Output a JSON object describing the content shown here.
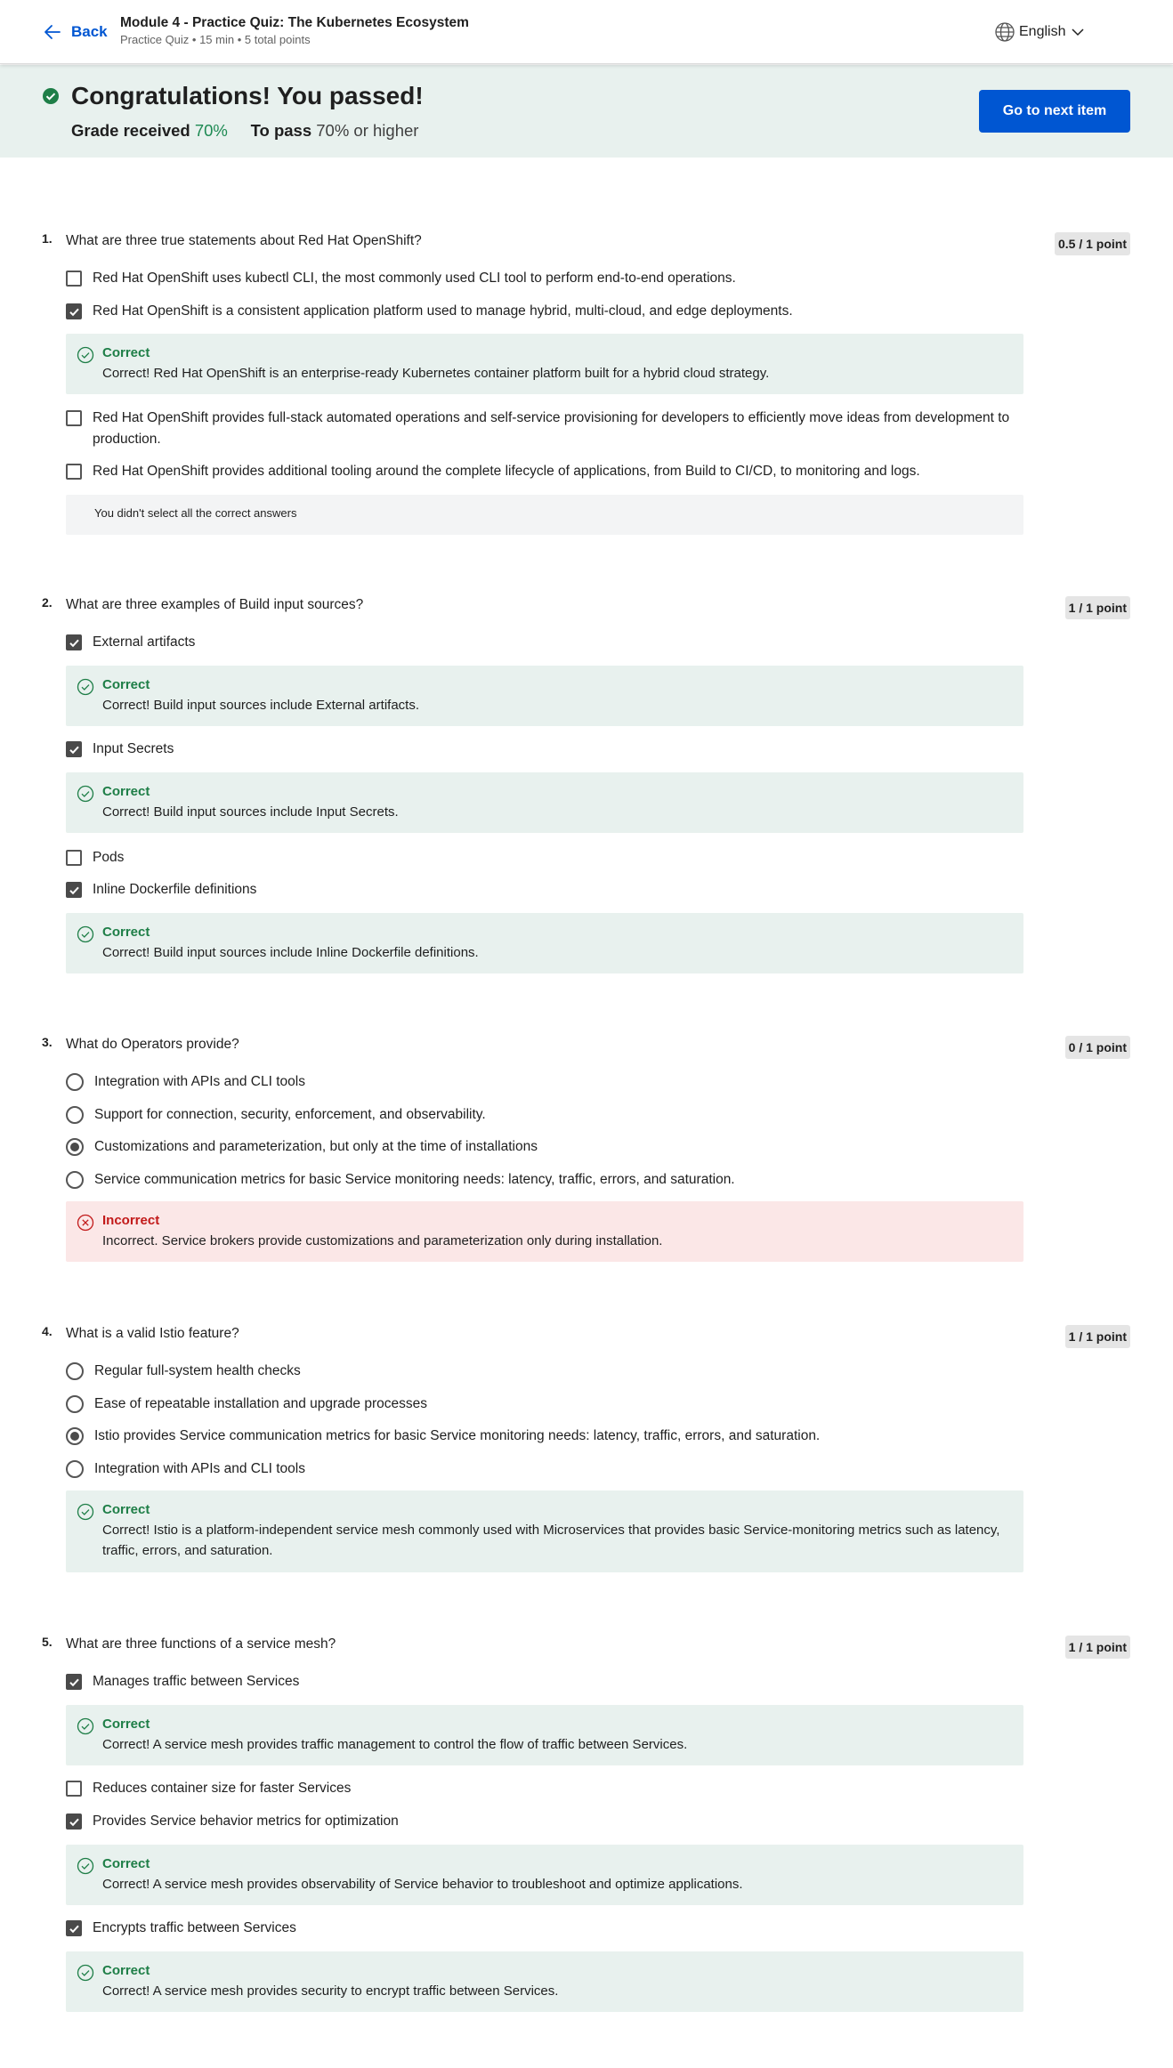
{
  "header": {
    "back_label": "Back",
    "title": "Module 4 - Practice Quiz: The Kubernetes Ecosystem",
    "subtitle": "Practice Quiz • 15 min • 5 total points",
    "language": "English"
  },
  "banner": {
    "message": "Congratulations! You passed!",
    "grade_label": "Grade received",
    "grade_value": "70%",
    "pass_label": "To pass",
    "pass_value": "70% or higher",
    "next_button": "Go to next item"
  },
  "colors": {
    "accent": "#0056d2",
    "correct": "#1e7e47",
    "incorrect": "#c21a1a",
    "correct_bg": "#e8f1ee",
    "incorrect_bg": "#fbe7e7"
  },
  "questions": [
    {
      "number": "1.",
      "text": "What are three true statements about Red Hat OpenShift?",
      "points": "0.5 / 1 point",
      "options": [
        {
          "label": "Red Hat OpenShift uses kubectl CLI, the most commonly used CLI tool to perform end-to-end operations.",
          "checked": false
        },
        {
          "label": "Red Hat OpenShift is a consistent application platform used to manage hybrid, multi-cloud, and edge deployments.",
          "checked": true,
          "feedback": {
            "status": "Correct",
            "text": "Correct! Red Hat OpenShift is an enterprise-ready Kubernetes container platform built for a hybrid cloud strategy."
          }
        },
        {
          "label": "Red Hat OpenShift provides full-stack automated operations and self-service provisioning for developers to efficiently move ideas from development to production.",
          "checked": false
        },
        {
          "label": "Red Hat OpenShift provides additional tooling around the complete lifecycle of applications, from Build to CI/CD, to monitoring and logs.",
          "checked": false
        }
      ],
      "note": "You didn't select all the correct answers"
    },
    {
      "number": "2.",
      "text": "What are three examples of Build input sources?",
      "points": "1 / 1 point",
      "options": [
        {
          "label": "External artifacts",
          "checked": true,
          "feedback": {
            "status": "Correct",
            "text": "Correct! Build input sources include External artifacts."
          }
        },
        {
          "label": "Input Secrets",
          "checked": true,
          "feedback": {
            "status": "Correct",
            "text": "Correct! Build input sources include Input Secrets."
          }
        },
        {
          "label": "Pods",
          "checked": false
        },
        {
          "label": "Inline Dockerfile definitions",
          "checked": true,
          "feedback": {
            "status": "Correct",
            "text": "Correct! Build input sources include Inline Dockerfile definitions."
          }
        }
      ]
    },
    {
      "number": "3.",
      "text": "What do Operators provide?",
      "points": "0 / 1 point",
      "options": [
        {
          "label": "Integration with APIs and CLI tools",
          "selected": false
        },
        {
          "label": "Support for connection, security, enforcement, and observability.",
          "selected": false
        },
        {
          "label": "Customizations and parameterization, but only at the time of installations",
          "selected": true
        },
        {
          "label": "Service communication metrics for basic Service monitoring needs: latency, traffic, errors, and saturation.",
          "selected": false
        }
      ],
      "feedback": {
        "status": "Incorrect",
        "text": "Incorrect. Service brokers provide customizations and parameterization only during installation."
      }
    },
    {
      "number": "4.",
      "text": "What is a valid Istio feature?",
      "points": "1 / 1 point",
      "options": [
        {
          "label": "Regular full-system health checks",
          "selected": false
        },
        {
          "label": "Ease of repeatable installation and upgrade processes",
          "selected": false
        },
        {
          "label": "Istio provides Service communication metrics for basic Service monitoring needs: latency, traffic, errors, and saturation.",
          "selected": true
        },
        {
          "label": "Integration with APIs and CLI tools",
          "selected": false
        }
      ],
      "feedback": {
        "status": "Correct",
        "text": "Correct! Istio is a platform-independent service mesh commonly used with Microservices that provides basic Service-monitoring metrics such as latency, traffic, errors, and saturation."
      }
    },
    {
      "number": "5.",
      "text": "What are three functions of a service mesh?",
      "points": "1 / 1 point",
      "options": [
        {
          "label": "Manages traffic between Services",
          "checked": true,
          "feedback": {
            "status": "Correct",
            "text": "Correct! A service mesh provides traffic management to control the flow of traffic between Services."
          }
        },
        {
          "label": "Reduces container size for faster Services",
          "checked": false
        },
        {
          "label": "Provides Service behavior metrics for optimization",
          "checked": true,
          "feedback": {
            "status": "Correct",
            "text": "Correct! A service mesh provides observability of Service behavior to troubleshoot and optimize applications."
          }
        },
        {
          "label": "Encrypts traffic between Services",
          "checked": true,
          "feedback": {
            "status": "Correct",
            "text": "Correct! A service mesh provides security to encrypt traffic between Services."
          }
        }
      ]
    }
  ]
}
